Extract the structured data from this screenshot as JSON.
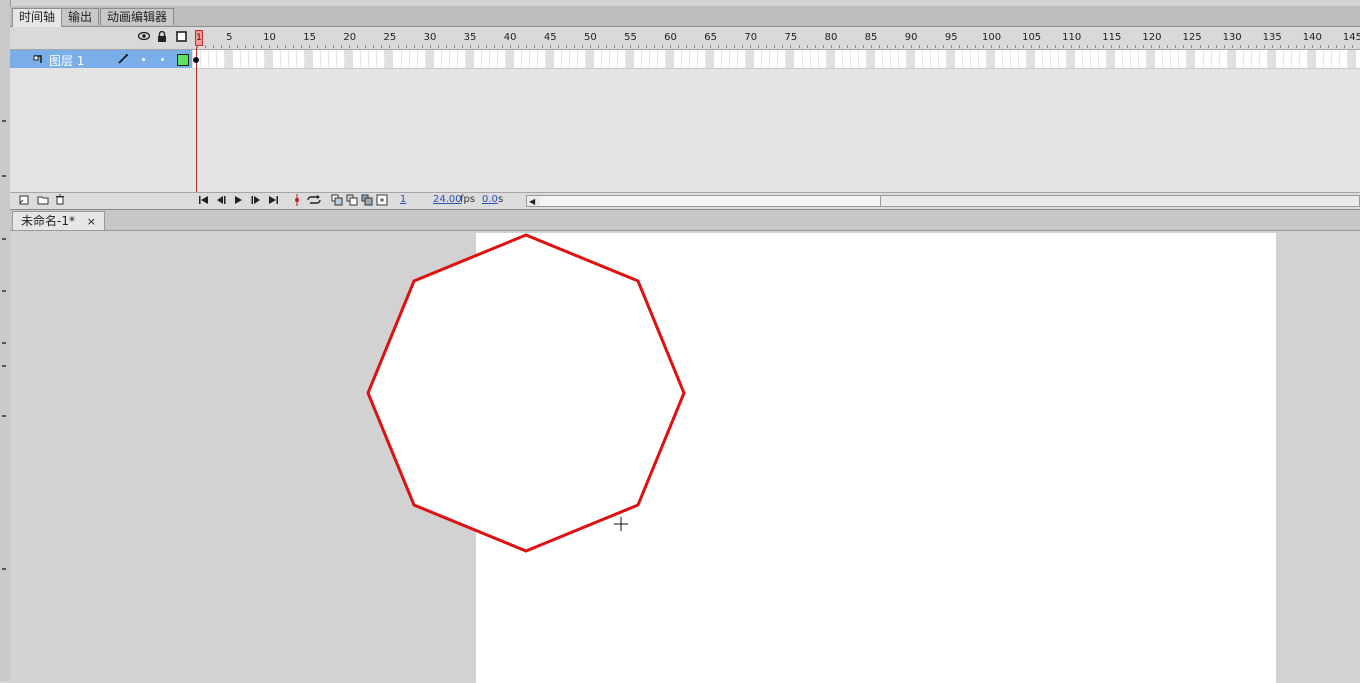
{
  "panel_tabs": [
    "时间轴",
    "输出",
    "动画编辑器"
  ],
  "layer": {
    "name": "图层 1"
  },
  "ruler_labels": [
    "1",
    "5",
    "10",
    "15",
    "20",
    "25",
    "30",
    "35",
    "40",
    "45",
    "50",
    "55",
    "60",
    "65",
    "70",
    "75",
    "80",
    "85",
    "90",
    "95",
    "100",
    "105",
    "110",
    "115",
    "120",
    "125",
    "130",
    "135",
    "140",
    "145"
  ],
  "status": {
    "frame": "1",
    "fps": "24.00",
    "fps_unit": "fps",
    "time": "0.0",
    "time_unit": "s"
  },
  "document": {
    "tab_title": "未命名-1*",
    "close": "×"
  },
  "shape": {
    "type": "octagon",
    "stroke_color": "#e01010",
    "fill_color": "#ffffff"
  },
  "icons": {
    "eye": "eye-icon",
    "lock": "lock-icon",
    "outline": "outline-icon",
    "pencil": "pencil-icon",
    "cursor": "crosshair-cursor-icon"
  }
}
